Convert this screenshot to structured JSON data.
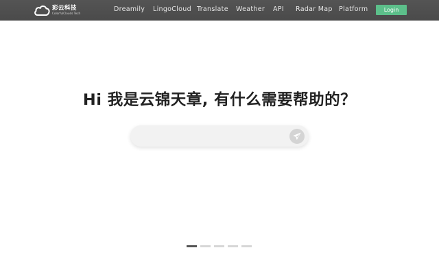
{
  "header": {
    "brand_name": "彩云科技",
    "brand_sub": "ColorfulClouds Tech",
    "nav": [
      {
        "label": "Dreamily"
      },
      {
        "label": "LingoCloud"
      },
      {
        "label": "Translate"
      },
      {
        "label": "Weather"
      },
      {
        "label": "API"
      },
      {
        "label": "Radar Map"
      },
      {
        "label": "Platform"
      }
    ],
    "login_label": "Login"
  },
  "main": {
    "headline": "Hi 我是云锦天章, 有什么需要帮助的？",
    "search": {
      "value": "",
      "placeholder": ""
    }
  },
  "carousel": {
    "slide_count": 5,
    "active_index": 0
  },
  "colors": {
    "topbar": "#4e4e4e",
    "login_button": "#5cbf8a",
    "headline": "#222222"
  },
  "icons": {
    "logo": "cloud-logo-icon",
    "send": "paper-plane-icon"
  }
}
